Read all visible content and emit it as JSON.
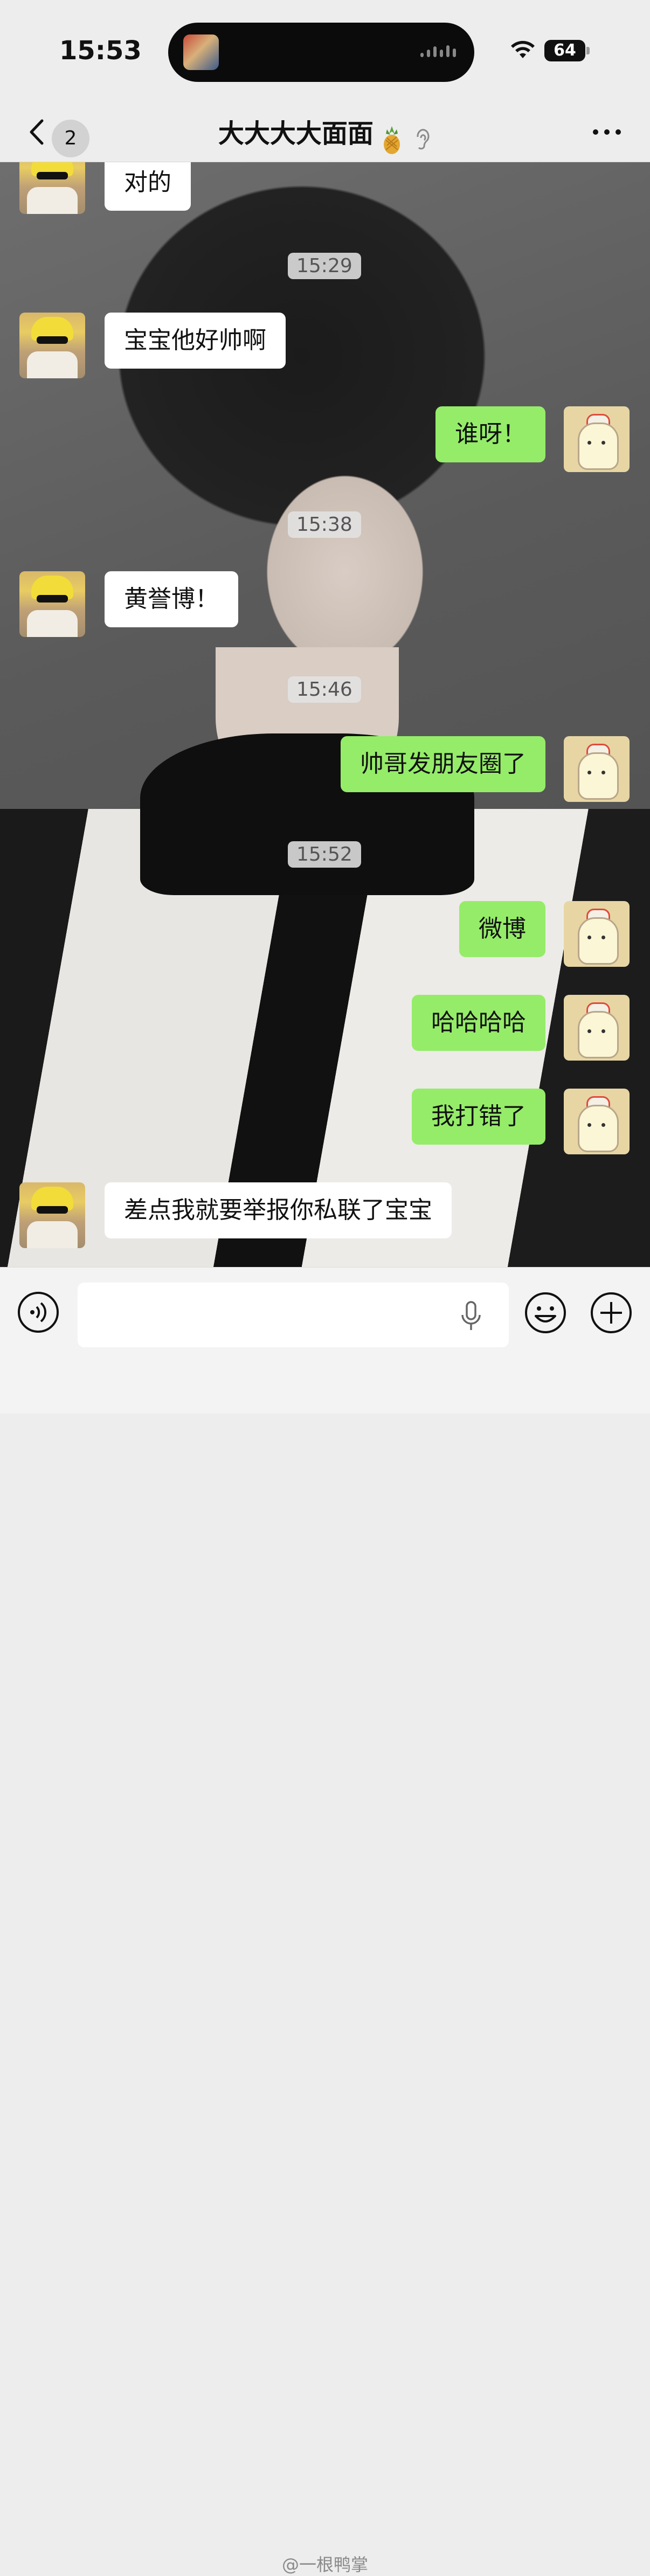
{
  "status_bar": {
    "time": "15:53",
    "battery": "64"
  },
  "nav": {
    "back_count": "2",
    "title": "大大大大面面"
  },
  "messages": [
    {
      "side": "left",
      "text": "对的"
    },
    {
      "time": "15:29"
    },
    {
      "side": "left",
      "text": "宝宝他好帅啊"
    },
    {
      "side": "right",
      "text": "谁呀！"
    },
    {
      "time": "15:38"
    },
    {
      "side": "left",
      "text": "黄誉博！"
    },
    {
      "time": "15:46"
    },
    {
      "side": "right",
      "text": "帅哥发朋友圈了"
    },
    {
      "time": "15:52"
    },
    {
      "side": "right",
      "text": "微博"
    },
    {
      "side": "right",
      "text": "哈哈哈哈"
    },
    {
      "side": "right",
      "text": "我打错了"
    },
    {
      "side": "left",
      "text": "差点我就要举报你私联了宝宝"
    }
  ],
  "input": {
    "value": ""
  },
  "watermark": "@一根鸭掌",
  "colors": {
    "sent_bubble": "#95ec69",
    "received_bubble": "#ffffff",
    "background": "#ededed"
  }
}
